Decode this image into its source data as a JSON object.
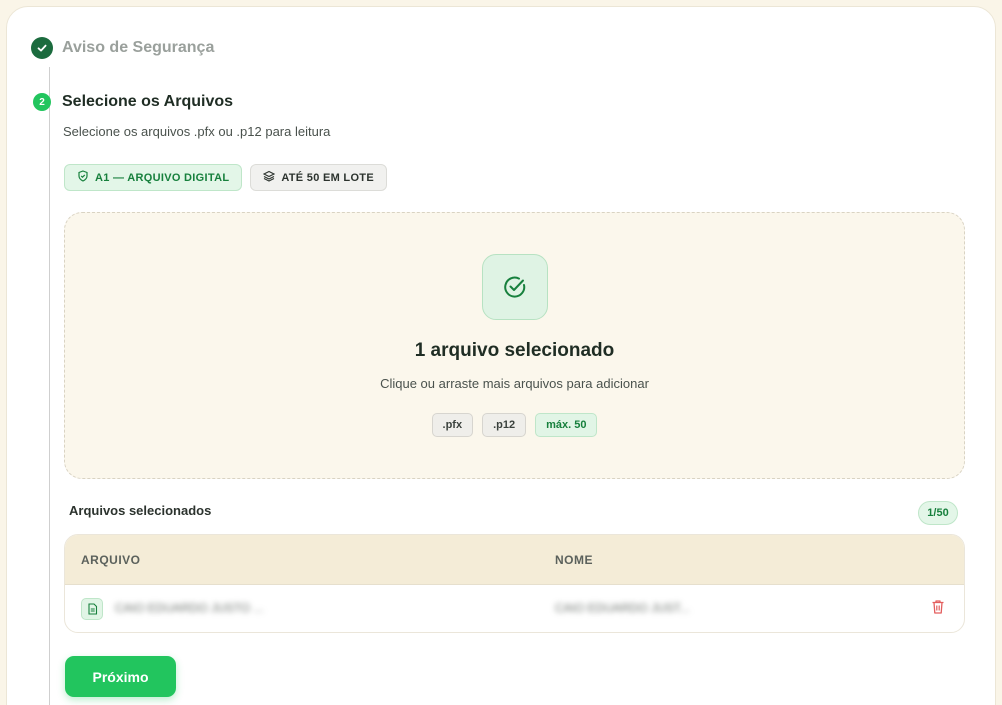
{
  "steps": {
    "step1": {
      "title": "Aviso de Segurança"
    },
    "step2": {
      "number": "2",
      "title": "Selecione os Arquivos",
      "subtitle": "Selecione os arquivos .pfx ou .p12 para leitura"
    }
  },
  "tags": {
    "a1": "A1 — ARQUIVO DIGITAL",
    "batch": "ATÉ 50 EM LOTE"
  },
  "dropzone": {
    "title": "1 arquivo selecionado",
    "subtitle": "Clique ou arraste mais arquivos para adicionar",
    "pills": [
      ".pfx",
      ".p12",
      "máx. 50"
    ]
  },
  "files": {
    "label": "Arquivos selecionados",
    "count": "1/50",
    "columns": [
      "ARQUIVO",
      "NOME"
    ],
    "rows": [
      {
        "file": "CAIO EDUARDO JUSTO ...",
        "name": "CAIO EDUARDO JUST..."
      }
    ]
  },
  "actions": {
    "next_label": "Próximo"
  },
  "colors": {
    "accent": "#22c55e",
    "accent_dark": "#1b6b3e",
    "background": "#faf5e8",
    "danger": "#e35d5d"
  },
  "icons": {
    "step1": "check-icon",
    "tag_a1": "shield-check-icon",
    "tag_batch": "layers-icon",
    "dropzone": "circle-check-icon",
    "file": "file-icon",
    "delete": "trash-icon"
  }
}
